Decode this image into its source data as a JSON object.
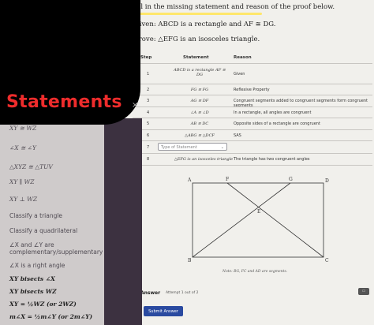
{
  "panel": {
    "title": "Statements",
    "close_icon": "×",
    "chips": [
      "XY ≅ WZ",
      "∠X ≅ ∠Y",
      "△XYZ ≅ △TUV",
      "XY ∥ WZ",
      "XY ⊥ WZ",
      "Classify a triangle",
      "Classify a quadrilateral",
      "∠X and ∠Y are complementary/supplementary",
      "∠X is a right angle",
      "XY bisects ∠X",
      "XY bisects WZ",
      "XY = ½WZ (or 2WZ)",
      "m∠X = ½m∠Y (or 2m∠Y)"
    ]
  },
  "worksheet": {
    "instruction": "Fill in the missing statement and reason of the proof below.",
    "given": "Given: ABCD is a rectangle and AF ≅ DG.",
    "prove": "Prove: △EFG is an isosceles triangle.",
    "headers": {
      "step": "Step",
      "statement": "Statement",
      "reason": "Reason"
    },
    "rows": [
      {
        "step": "1",
        "statement": "ABCD is a rectangle AF ≅ DG",
        "reason": "Given"
      },
      {
        "step": "2",
        "statement": "FG ≅ FG",
        "reason": "Reflexive Property"
      },
      {
        "step": "3",
        "statement": "AG ≅ DF",
        "reason": "Congruent segments added to congruent segments form congruent segments"
      },
      {
        "step": "4",
        "statement": "∠A ≅ ∠D",
        "reason": "In a rectangle, all angles are congruent"
      },
      {
        "step": "5",
        "statement": "AB ≅ DC",
        "reason": "Opposite sides of a rectangle are congruent"
      },
      {
        "step": "6",
        "statement": "△ABG ≅ △DCF",
        "reason": "SAS"
      },
      {
        "step": "7",
        "statement": "",
        "reason": ""
      },
      {
        "step": "8",
        "statement": "△EFG is an isosceles triangle",
        "reason": "The triangle has two congruent angles"
      }
    ],
    "dropdown_placeholder": "Type of Statement",
    "dropdown_chevron": "⌄",
    "diagram_labels": {
      "A": "A",
      "F": "F",
      "G": "G",
      "D": "D",
      "E": "E",
      "B": "B",
      "C": "C"
    },
    "diagram_note": "Note: BG, FC and AD are segments.",
    "answer_label": "Answer",
    "attempt_label": "Attempt 1 out of 2",
    "submit_label": "Submit Answer",
    "corner_icon": "▭"
  },
  "colors": {
    "statements_label": "#ee2c2c",
    "highlight": "#ffe66b",
    "submit": "#2a4aa0",
    "panel_bg": "#cfcbcb",
    "strip_bg": "#3c3140"
  }
}
